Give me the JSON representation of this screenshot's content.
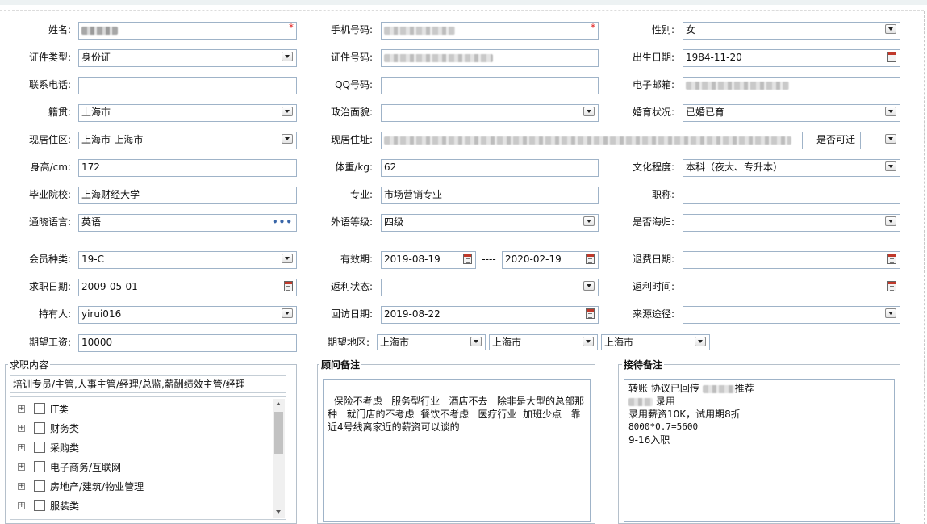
{
  "form": {
    "name": {
      "label": "姓名:",
      "required": "*"
    },
    "mobile": {
      "label": "手机号码:",
      "required": "*"
    },
    "gender": {
      "label": "性别:",
      "value": "女"
    },
    "id_type": {
      "label": "证件类型:",
      "value": "身份证"
    },
    "id_no": {
      "label": "证件号码:"
    },
    "birthday": {
      "label": "出生日期:",
      "value": "1984-11-20"
    },
    "phone": {
      "label": "联系电话:",
      "value": ""
    },
    "qq": {
      "label": "QQ号码:",
      "value": ""
    },
    "email": {
      "label": "电子邮箱:"
    },
    "native_place": {
      "label": "籍贯:",
      "value": "上海市"
    },
    "politics": {
      "label": "政治面貌:",
      "value": ""
    },
    "marital": {
      "label": "婚育状况:",
      "value": "已婚已育"
    },
    "residence_area": {
      "label": "现居住区:",
      "value": "上海市-上海市"
    },
    "address": {
      "label": "现居住址:"
    },
    "relocatable": {
      "label": "是否可迁",
      "value": ""
    },
    "height": {
      "label": "身高/cm:",
      "value": "172"
    },
    "weight": {
      "label": "体重/kg:",
      "value": "62"
    },
    "education": {
      "label": "文化程度:",
      "value": "本科（夜大、专升本）"
    },
    "school": {
      "label": "毕业院校:",
      "value": "上海财经大学"
    },
    "major": {
      "label": "专业:",
      "value": "市场营销专业"
    },
    "title": {
      "label": "职称:",
      "value": ""
    },
    "language": {
      "label": "通晓语言:",
      "value": "英语"
    },
    "lang_level": {
      "label": "外语等级:",
      "value": "四级"
    },
    "returnee": {
      "label": "是否海归:",
      "value": ""
    },
    "member_type": {
      "label": "会员种类:",
      "value": "19-C"
    },
    "valid_period": {
      "label": "有效期:",
      "from": "2019-08-19",
      "sep": "----",
      "to": "2020-02-19"
    },
    "refund_date": {
      "label": "退费日期:",
      "value": ""
    },
    "job_date": {
      "label": "求职日期:",
      "value": "2009-05-01"
    },
    "rebate_status": {
      "label": "返利状态:",
      "value": ""
    },
    "rebate_time": {
      "label": "返利时间:",
      "value": ""
    },
    "holder": {
      "label": "持有人:",
      "value": "yirui016"
    },
    "visit_date": {
      "label": "回访日期:",
      "value": "2019-08-22"
    },
    "source": {
      "label": "来源途径:",
      "value": ""
    },
    "salary": {
      "label": "期望工资:",
      "value": "10000"
    },
    "region": {
      "label": "期望地区:",
      "values": [
        "上海市",
        "上海市",
        "上海市"
      ]
    }
  },
  "job_section": {
    "title": "求职内容",
    "summary": "培训专员/主管,人事主管/经理/总监,薪酬绩效主管/经理",
    "categories": [
      "IT类",
      "财务类",
      "采购类",
      "电子商务/互联网",
      "房地产/建筑/物业管理",
      "服装类"
    ]
  },
  "advisor_notes": {
    "title": "顾问备注",
    "text": "保险不考虑   服务型行业   酒店不去   除非是大型的总部那种   就门店的不考虑  餐饮不考虑   医疗行业  加班少点   靠近4号线离家近的薪资可以谈的"
  },
  "reception_notes": {
    "title": "接待备注",
    "line1_pre": "转账 协议已回传",
    "line1_post": "推荐",
    "line2_post": "录用",
    "line3": "录用薪资10K，试用期8折",
    "line4": "8000*0.7=5600",
    "line5": "9-16入职"
  }
}
